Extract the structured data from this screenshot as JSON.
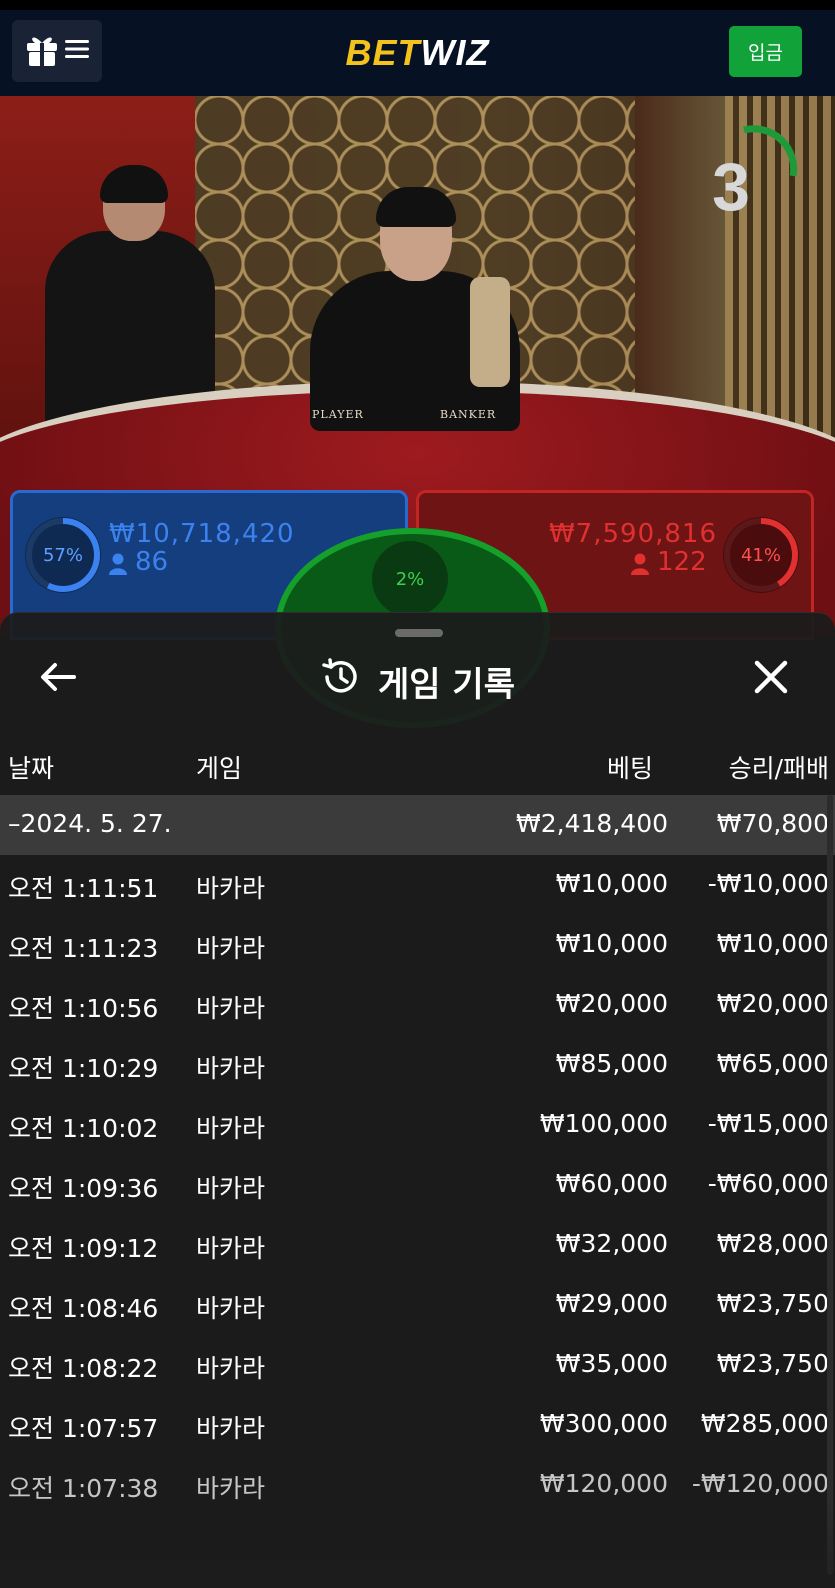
{
  "header": {
    "logo_bet": "BET",
    "logo_wiz": "WIZ",
    "deposit_label": "입금",
    "icons": [
      "gift-icon",
      "menu-icon"
    ]
  },
  "live": {
    "countdown": "3",
    "felt_player": "PLAYER",
    "felt_banker": "BANKER",
    "player": {
      "pct": "57%",
      "amount": "₩10,718,420",
      "count": "86"
    },
    "banker": {
      "pct": "41%",
      "amount": "₩7,590,816",
      "count": "122"
    },
    "tie": {
      "pct": "2%"
    }
  },
  "history": {
    "title": "게임 기록",
    "icons": [
      "back-arrow-icon",
      "history-icon",
      "close-icon"
    ],
    "columns": {
      "date": "날짜",
      "game": "게임",
      "bet": "베팅",
      "result": "승리/패배"
    },
    "summary": {
      "date": "–2024. 5. 27.",
      "bet": "₩2,418,400",
      "result": "₩70,800"
    },
    "rows": [
      {
        "time": "오전 1:11:51",
        "game": "바카라",
        "bet": "₩10,000",
        "result": "-₩10,000"
      },
      {
        "time": "오전 1:11:23",
        "game": "바카라",
        "bet": "₩10,000",
        "result": "₩10,000"
      },
      {
        "time": "오전 1:10:56",
        "game": "바카라",
        "bet": "₩20,000",
        "result": "₩20,000"
      },
      {
        "time": "오전 1:10:29",
        "game": "바카라",
        "bet": "₩85,000",
        "result": "₩65,000"
      },
      {
        "time": "오전 1:10:02",
        "game": "바카라",
        "bet": "₩100,000",
        "result": "-₩15,000"
      },
      {
        "time": "오전 1:09:36",
        "game": "바카라",
        "bet": "₩60,000",
        "result": "-₩60,000"
      },
      {
        "time": "오전 1:09:12",
        "game": "바카라",
        "bet": "₩32,000",
        "result": "₩28,000"
      },
      {
        "time": "오전 1:08:46",
        "game": "바카라",
        "bet": "₩29,000",
        "result": "₩23,750"
      },
      {
        "time": "오전 1:08:22",
        "game": "바카라",
        "bet": "₩35,000",
        "result": "₩23,750"
      },
      {
        "time": "오전 1:07:57",
        "game": "바카라",
        "bet": "₩300,000",
        "result": "₩285,000"
      },
      {
        "time": "오전 1:07:38",
        "game": "바카라",
        "bet": "₩120,000",
        "result": "-₩120,000"
      }
    ]
  },
  "colors": {
    "topbar": "#071124",
    "logo_yellow": "#f3c21c",
    "deposit_green": "#11a33a",
    "player_blue": "#2a6ad0",
    "banker_red": "#c32424",
    "tie_green": "#14a02a",
    "sheet_bg": "#1c1c1c",
    "summary_row": "#3b3b3b"
  }
}
